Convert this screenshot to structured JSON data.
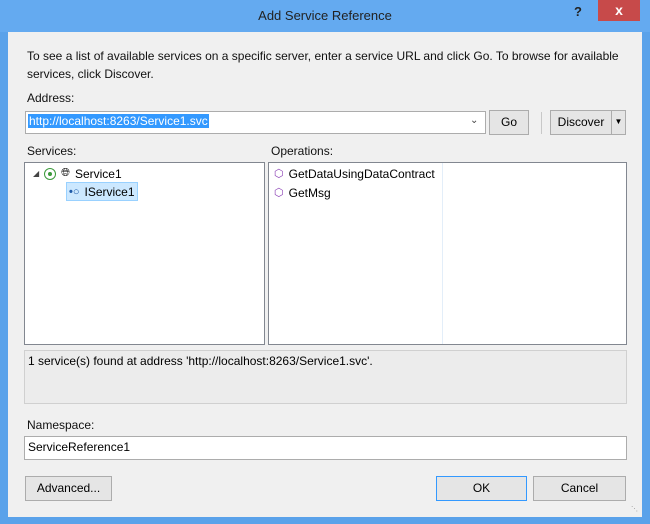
{
  "window": {
    "title": "Add Service Reference",
    "help_label": "?",
    "close_label": "x"
  },
  "intro": "To see a list of available services on a specific server, enter a service URL and click Go. To browse for available services, click Discover.",
  "address": {
    "label": "Address:",
    "value": "http://localhost:8263/Service1.svc",
    "go_label": "Go",
    "discover_label": "Discover"
  },
  "services": {
    "label": "Services:",
    "root": "Service1",
    "child": "IService1"
  },
  "operations": {
    "label": "Operations:",
    "items": [
      "GetDataUsingDataContract",
      "GetMsg"
    ]
  },
  "status": "1 service(s) found at address 'http://localhost:8263/Service1.svc'.",
  "namespace": {
    "label": "Namespace:",
    "value": "ServiceReference1"
  },
  "buttons": {
    "advanced": "Advanced...",
    "ok": "OK",
    "cancel": "Cancel"
  },
  "colors": {
    "accent": "#3399ff",
    "titlebar": "#64aaf0",
    "close": "#c74a4a",
    "operation_icon": "#8a3fb5"
  }
}
